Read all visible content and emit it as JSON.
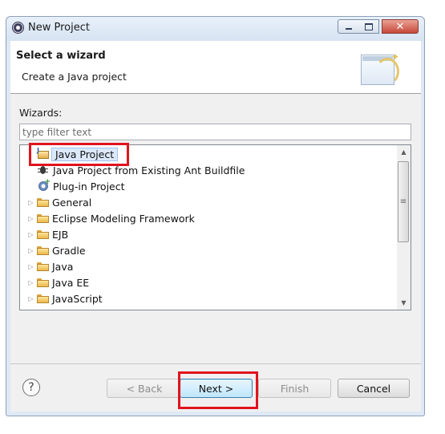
{
  "window": {
    "title": "New Project",
    "minimize_icon": "minimize-icon",
    "maximize_icon": "maximize-icon",
    "close_icon": "close-icon"
  },
  "header": {
    "title": "Select a wizard",
    "description": "Create a Java project"
  },
  "wizards": {
    "label": "Wizards:",
    "filter_placeholder": "type filter text",
    "filter_value": ""
  },
  "tree": {
    "items": [
      {
        "label": "Java Project",
        "icon": "java-project-icon",
        "selected": true,
        "expandable": false
      },
      {
        "label": "Java Project from Existing Ant Buildfile",
        "icon": "ant-icon",
        "selected": false,
        "expandable": false
      },
      {
        "label": "Plug-in Project",
        "icon": "plugin-project-icon",
        "selected": false,
        "expandable": false
      },
      {
        "label": "General",
        "icon": "folder-icon",
        "expandable": true
      },
      {
        "label": "Eclipse Modeling Framework",
        "icon": "folder-icon",
        "expandable": true
      },
      {
        "label": "EJB",
        "icon": "folder-icon",
        "expandable": true
      },
      {
        "label": "Gradle",
        "icon": "folder-icon",
        "expandable": true
      },
      {
        "label": "Java",
        "icon": "folder-icon",
        "expandable": true
      },
      {
        "label": "Java EE",
        "icon": "folder-icon",
        "expandable": true
      },
      {
        "label": "JavaScript",
        "icon": "folder-icon",
        "expandable": true
      }
    ]
  },
  "buttons": {
    "help": "?",
    "back": "< Back",
    "next": "Next >",
    "finish": "Finish",
    "cancel": "Cancel",
    "back_enabled": false,
    "finish_enabled": false
  },
  "colors": {
    "highlight": "#e0141e",
    "selection": "#dbe9fb"
  }
}
